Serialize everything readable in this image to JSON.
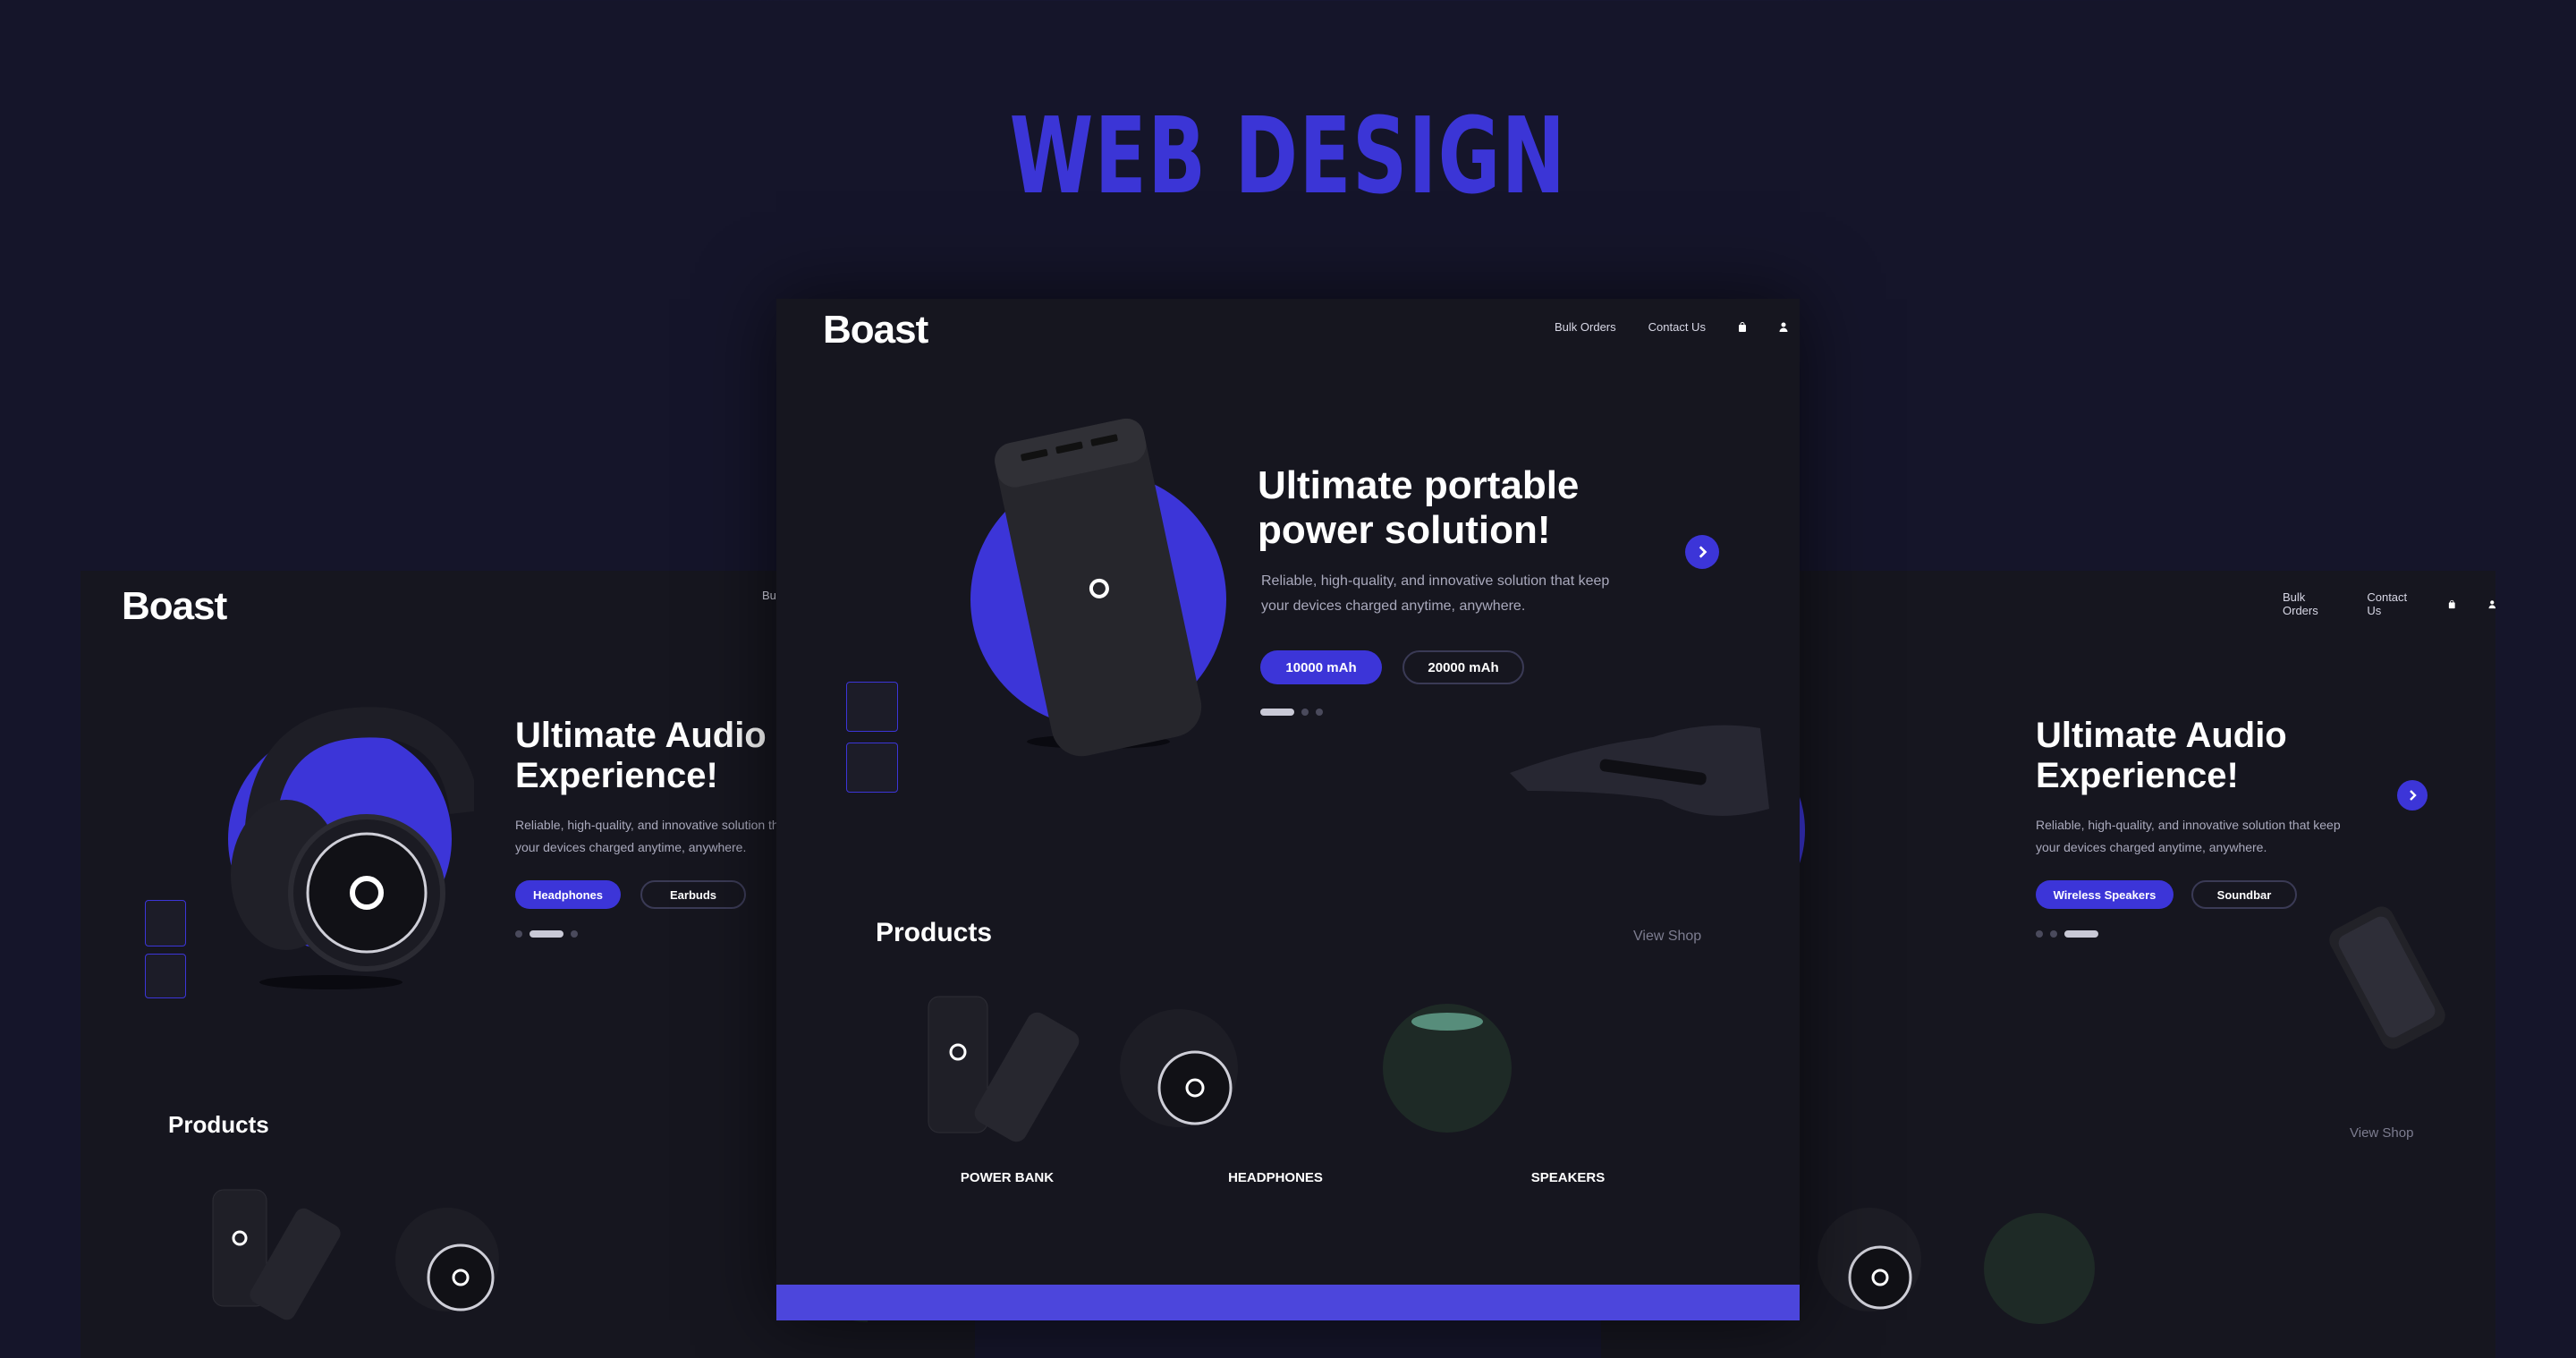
{
  "heading": "WEB DESIGN",
  "colors": {
    "accent": "#3c35d8",
    "background": "#15152a",
    "panel": "#16161f"
  },
  "center": {
    "logo": "Boast",
    "nav": [
      "Bulk Orders",
      "Contact Us"
    ],
    "nav_icons": [
      "bag-icon",
      "user-icon"
    ],
    "hero_title_line1": "Ultimate portable",
    "hero_title_line2": "power solution!",
    "hero_text_line1": "Reliable, high-quality, and innovative solution that keep",
    "hero_text_line2": "your devices charged anytime, anywhere.",
    "options": [
      "10000 mAh",
      "20000 mAh"
    ],
    "selected_option": "10000 mAh",
    "products_title": "Products",
    "view_shop": "View Shop",
    "products": [
      "POWER BANK",
      "HEADPHONES",
      "SPEAKERS"
    ]
  },
  "left": {
    "logo": "Boast",
    "nav_partial": "Bul",
    "hero_title_line1": "Ultimate Audio",
    "hero_title_line2": "Experience!",
    "hero_text_line1": "Reliable, high-quality, and innovative solution tha",
    "hero_text_line2": "your devices charged anytime, anywhere.",
    "options": [
      "Headphones",
      "Earbuds"
    ],
    "products_title": "Products"
  },
  "right": {
    "nav": [
      "Bulk Orders",
      "Contact Us"
    ],
    "hero_title_line1": "Ultimate Audio",
    "hero_title_line2": "Experience!",
    "hero_text_line1": "Reliable, high-quality, and innovative solution that keep",
    "hero_text_line2": "your devices charged anytime, anywhere.",
    "options": [
      "Wireless Speakers",
      "Soundbar"
    ],
    "view_shop": "View Shop"
  }
}
